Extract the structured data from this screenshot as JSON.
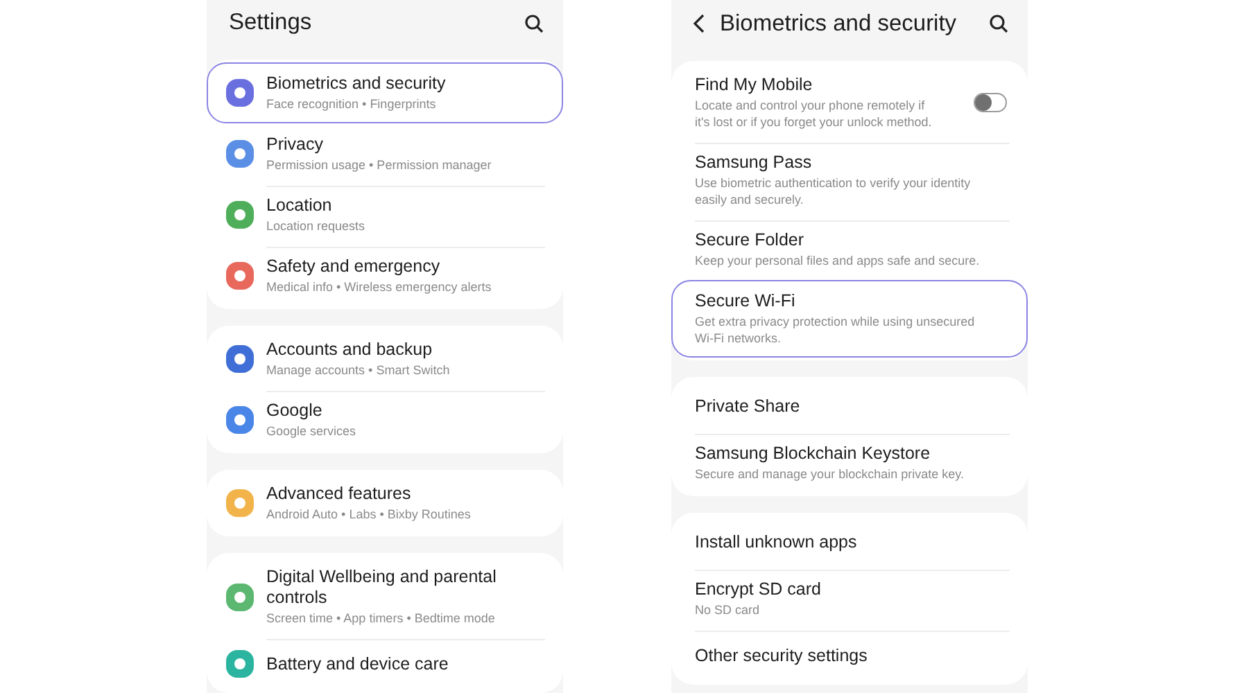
{
  "screens": [
    {
      "title": "Settings",
      "back": false,
      "groups": [
        {
          "items": [
            {
              "title": "Biometrics and security",
              "subtitle": "Face recognition  •  Fingerprints",
              "color": "#6a6fe0",
              "selected": true
            },
            {
              "title": "Privacy",
              "subtitle": "Permission usage  •  Permission manager",
              "color": "#5b8fe6",
              "selected": false
            },
            {
              "title": "Location",
              "subtitle": "Location requests",
              "color": "#4fae5a",
              "selected": false
            },
            {
              "title": "Safety and emergency",
              "subtitle": "Medical info  •  Wireless emergency alerts",
              "color": "#e8685c",
              "selected": false
            }
          ]
        },
        {
          "items": [
            {
              "title": "Accounts and backup",
              "subtitle": "Manage accounts  •  Smart Switch",
              "color": "#3f6fd6",
              "selected": false
            },
            {
              "title": "Google",
              "subtitle": "Google services",
              "color": "#4a86e8",
              "selected": false
            }
          ]
        },
        {
          "items": [
            {
              "title": "Advanced features",
              "subtitle": "Android Auto  •  Labs  •  Bixby Routines",
              "color": "#f2b44a",
              "selected": false
            }
          ]
        },
        {
          "items": [
            {
              "title": "Digital Wellbeing and parental controls",
              "subtitle": "Screen time  •  App timers  •  Bedtime mode",
              "color": "#5cb870",
              "selected": false
            },
            {
              "title": "Battery and device care",
              "color": "#2bb5a0",
              "selected": false
            }
          ]
        }
      ]
    },
    {
      "title": "Biometrics and security",
      "back": true,
      "groups": [
        {
          "items": [
            {
              "title": "Find My Mobile",
              "subtitle": "Locate and control your phone remotely if it's lost or if you forget your unlock method.",
              "toggle": false,
              "selected": false
            },
            {
              "title": "Samsung Pass",
              "subtitle": "Use biometric authentication to verify your identity easily and securely.",
              "selected": false
            },
            {
              "title": "Secure Folder",
              "subtitle": "Keep your personal files and apps safe and secure.",
              "selected": false
            },
            {
              "title": "Secure Wi-Fi",
              "subtitle": "Get extra privacy protection while using unsecured Wi-Fi networks.",
              "selected": true
            }
          ]
        },
        {
          "items": [
            {
              "title": "Private Share",
              "selected": false
            },
            {
              "title": "Samsung Blockchain Keystore",
              "subtitle": "Secure and manage your blockchain private key.",
              "selected": false
            }
          ]
        },
        {
          "items": [
            {
              "title": "Install unknown apps",
              "selected": false
            },
            {
              "title": "Encrypt SD card",
              "subtitle": "No SD card",
              "selected": false
            },
            {
              "title": "Other security settings",
              "selected": false
            }
          ]
        }
      ]
    }
  ]
}
